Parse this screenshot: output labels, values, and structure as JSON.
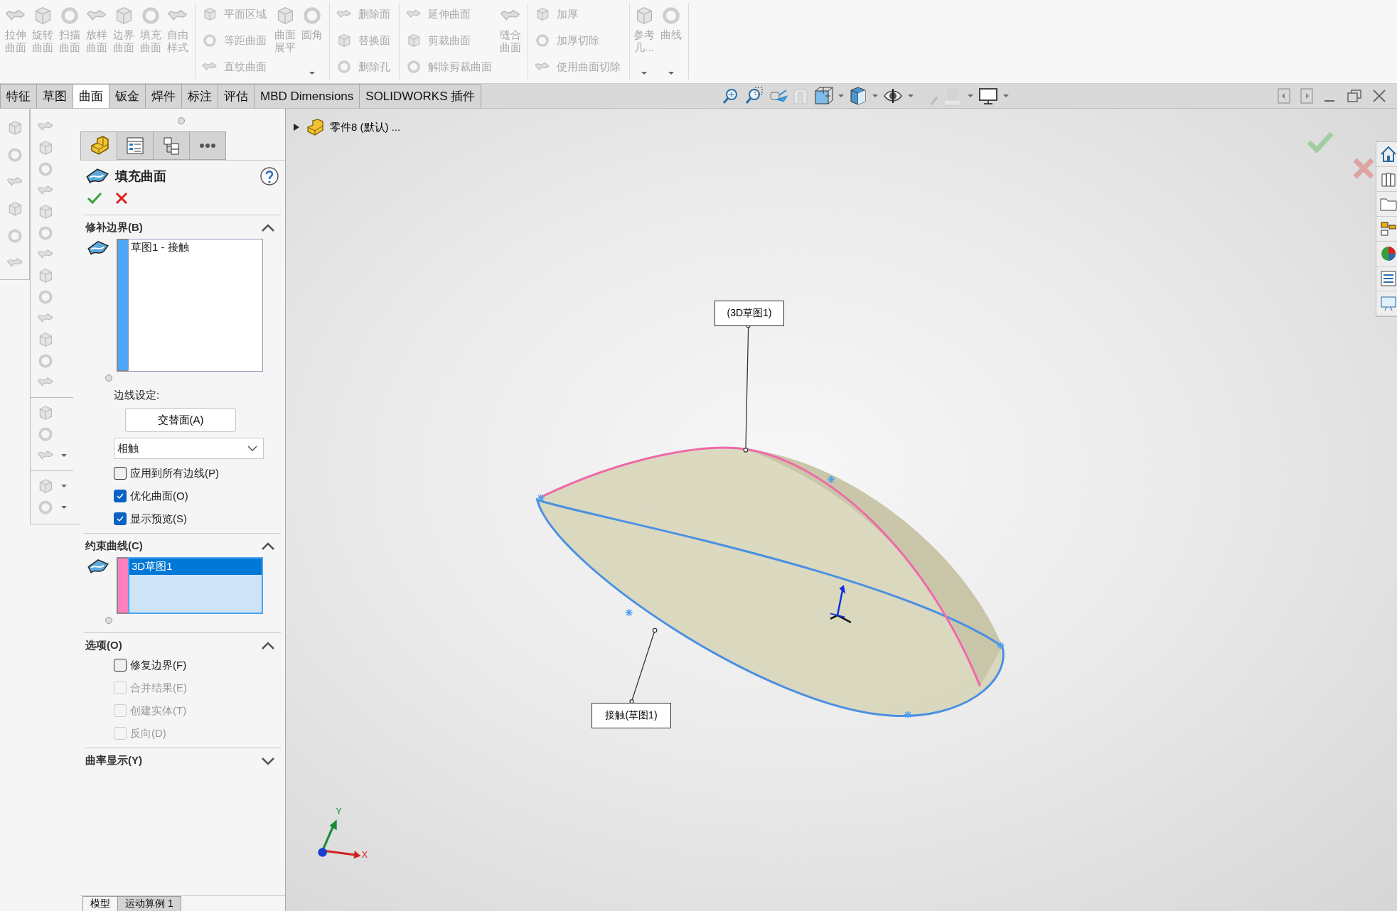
{
  "ribbon": {
    "groups": [
      {
        "columns": [
          {
            "kind": "large",
            "label": "拉伸曲面",
            "disabled": true,
            "menu": false
          },
          {
            "kind": "large",
            "label": "旋转曲面",
            "disabled": true,
            "menu": false
          },
          {
            "kind": "large",
            "label": "扫描曲面",
            "disabled": true,
            "menu": false
          },
          {
            "kind": "large",
            "label": "放样曲面",
            "disabled": true,
            "menu": false
          },
          {
            "kind": "large",
            "label": "边界曲面",
            "disabled": true,
            "menu": false
          },
          {
            "kind": "large",
            "label": "填充曲面",
            "disabled": true,
            "menu": false
          },
          {
            "kind": "large",
            "label": "自由样式",
            "disabled": true,
            "menu": false
          }
        ]
      },
      {
        "columns": [
          {
            "kind": "stack",
            "items": [
              {
                "label": "平面区域",
                "disabled": true
              },
              {
                "label": "等距曲面",
                "disabled": true
              },
              {
                "label": "直纹曲面",
                "disabled": true
              }
            ]
          },
          {
            "kind": "large",
            "label": "曲面展平",
            "disabled": true,
            "menu": false
          },
          {
            "kind": "large",
            "label": "圆角",
            "disabled": true,
            "menu": true
          }
        ]
      },
      {
        "columns": [
          {
            "kind": "stack",
            "items": [
              {
                "label": "删除面",
                "disabled": true
              },
              {
                "label": "替换面",
                "disabled": true
              },
              {
                "label": "删除孔",
                "disabled": true
              }
            ]
          }
        ]
      },
      {
        "columns": [
          {
            "kind": "stack",
            "items": [
              {
                "label": "延伸曲面",
                "disabled": true
              },
              {
                "label": "剪裁曲面",
                "disabled": true
              },
              {
                "label": "解除剪裁曲面",
                "disabled": true
              }
            ]
          },
          {
            "kind": "large",
            "label": "缝合曲面",
            "disabled": true,
            "menu": false
          }
        ]
      },
      {
        "columns": [
          {
            "kind": "stack",
            "items": [
              {
                "label": "加厚",
                "disabled": true
              },
              {
                "label": "加厚切除",
                "disabled": true
              },
              {
                "label": "使用曲面切除",
                "disabled": true
              }
            ]
          }
        ]
      },
      {
        "columns": [
          {
            "kind": "large",
            "label": "参考几...",
            "disabled": true,
            "menu": true
          },
          {
            "kind": "large",
            "label": "曲线",
            "disabled": true,
            "menu": true
          }
        ]
      }
    ]
  },
  "tabs": [
    {
      "label": "特征",
      "selected": false
    },
    {
      "label": "草图",
      "selected": false
    },
    {
      "label": "曲面",
      "selected": true
    },
    {
      "label": "钣金",
      "selected": false
    },
    {
      "label": "焊件",
      "selected": false
    },
    {
      "label": "标注",
      "selected": false
    },
    {
      "label": "评估",
      "selected": false
    },
    {
      "label": "MBD Dimensions",
      "selected": false
    },
    {
      "label": "SOLIDWORKS 插件",
      "selected": false
    }
  ],
  "property_manager": {
    "tabs": [
      {
        "selected": true
      },
      {
        "selected": false
      },
      {
        "selected": false
      },
      {
        "selected": false
      }
    ],
    "title": "填充曲面",
    "sections": [
      {
        "kind": "boundary",
        "title": "修补边界(B)",
        "expanded": true,
        "list": {
          "color": "#4fa6f8",
          "items": [
            {
              "label": "草图1 - 接触",
              "selected": false
            }
          ]
        },
        "edge_settings_label": "边线设定:",
        "button": "交替面(A)",
        "dropdown": "相触",
        "checkboxes": [
          {
            "label": "应用到所有边线(P)",
            "checked": false,
            "disabled": false
          },
          {
            "label": "优化曲面(O)",
            "checked": true,
            "disabled": false
          },
          {
            "label": "显示预览(S)",
            "checked": true,
            "disabled": false
          }
        ]
      },
      {
        "kind": "curves",
        "title": "约束曲线(C)",
        "expanded": true,
        "list": {
          "color": "#ff7fbf",
          "items": [
            {
              "label": "3D草图1",
              "selected": true
            }
          ]
        }
      },
      {
        "kind": "options",
        "title": "选项(O)",
        "expanded": true,
        "checkboxes": [
          {
            "label": "修复边界(F)",
            "checked": false,
            "disabled": false
          },
          {
            "label": "合并结果(E)",
            "checked": false,
            "disabled": true
          },
          {
            "label": "创建实体(T)",
            "checked": false,
            "disabled": true
          },
          {
            "label": "反向(D)",
            "checked": false,
            "disabled": true
          }
        ]
      },
      {
        "kind": "curvature",
        "title": "曲率显示(Y)",
        "expanded": false
      }
    ]
  },
  "bottom_tabs": [
    {
      "label": "模型",
      "selected": true
    },
    {
      "label": "运动算例 1",
      "selected": false
    }
  ],
  "viewport": {
    "tree": {
      "label": "零件8 (默认) ...",
      "expanded": false
    },
    "callouts": [
      {
        "label": "(3D草图1)"
      },
      {
        "label": "接触(草图1)"
      }
    ],
    "triad": {
      "y_label": "Y",
      "x_label": "X"
    }
  }
}
